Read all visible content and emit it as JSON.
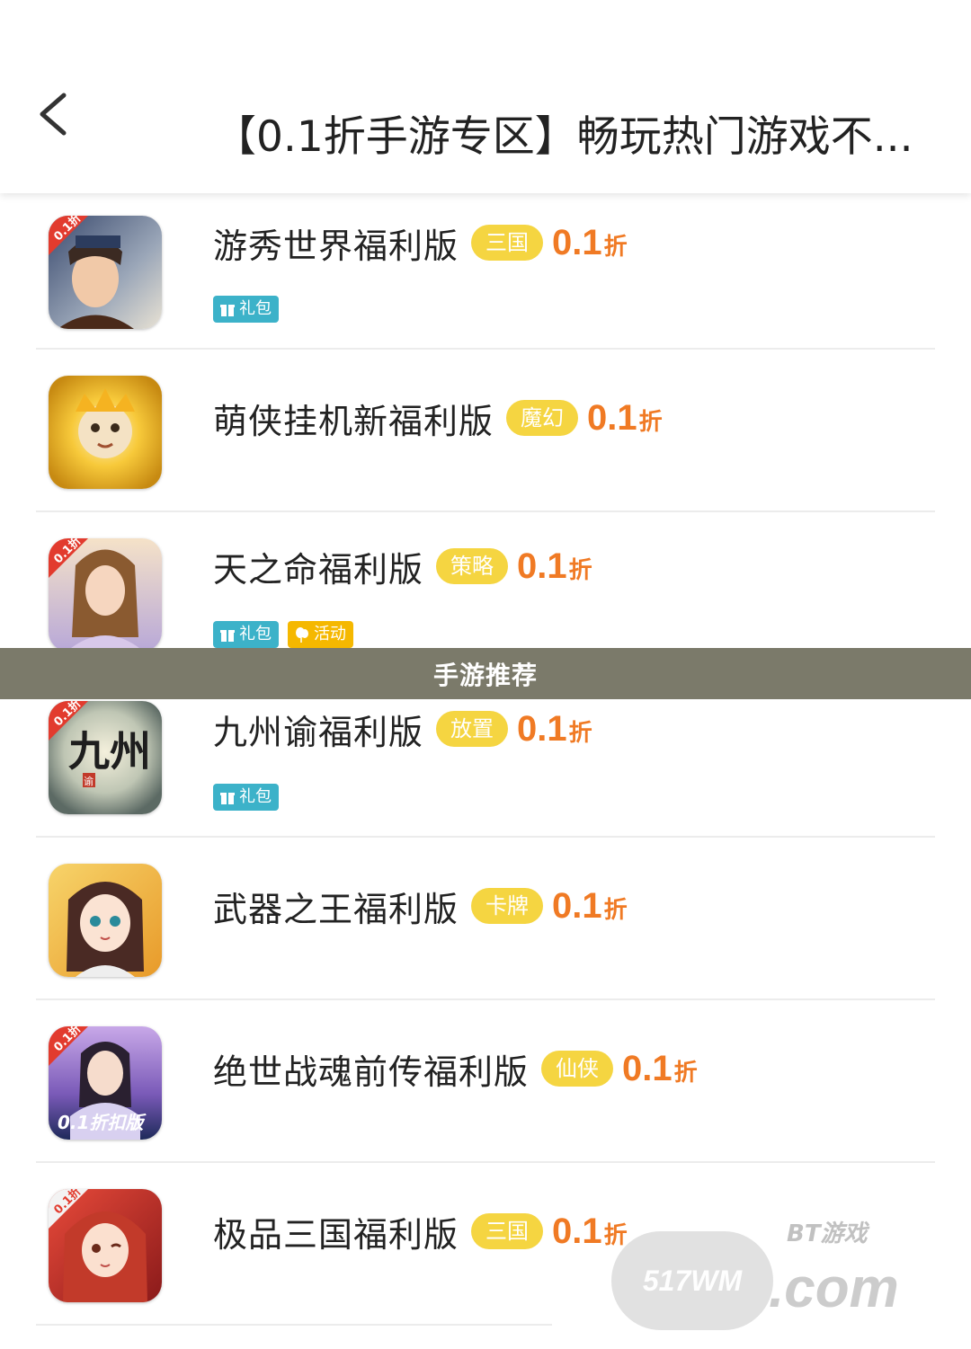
{
  "header": {
    "back_icon": "chevron-left-icon",
    "title": "【0.1折手游专区】畅玩热门游戏不..."
  },
  "overlay_banner": {
    "text": "手游推荐"
  },
  "discount_unit": "折",
  "games": [
    {
      "name": "游秀世界福利版",
      "genre": "三国",
      "discount": "0.1",
      "discount_unit": "折",
      "badges": [
        {
          "type": "gift",
          "label": "礼包"
        }
      ],
      "icon": "game-icon-warrior",
      "icon_label": "0.1折"
    },
    {
      "name": "萌侠挂机新福利版",
      "genre": "魔幻",
      "discount": "0.1",
      "discount_unit": "折",
      "badges": [],
      "icon": "game-icon-golden-monkey"
    },
    {
      "name": "天之命福利版",
      "genre": "策略",
      "discount": "0.1",
      "discount_unit": "折",
      "badges": [
        {
          "type": "gift",
          "label": "礼包"
        },
        {
          "type": "event",
          "label": "活动"
        }
      ],
      "icon": "game-icon-lady",
      "icon_label": "0.1折"
    },
    {
      "name": "九州谕福利版",
      "genre": "放置",
      "discount": "0.1",
      "discount_unit": "折",
      "badges": [
        {
          "type": "gift",
          "label": "礼包"
        }
      ],
      "icon": "game-icon-calligraphy",
      "icon_label": "0.1折",
      "icon_text": "九州",
      "icon_seal": "谕"
    },
    {
      "name": "武器之王福利版",
      "genre": "卡牌",
      "discount": "0.1",
      "discount_unit": "折",
      "badges": [],
      "icon": "game-icon-anime-girl"
    },
    {
      "name": "绝世战魂前传福利版",
      "genre": "仙侠",
      "discount": "0.1",
      "discount_unit": "折",
      "badges": [],
      "icon": "game-icon-fairy",
      "icon_label": "0.1折",
      "icon_text": "0.1折扣版"
    },
    {
      "name": "极品三国福利版",
      "genre": "三国",
      "discount": "0.1",
      "discount_unit": "折",
      "badges": [],
      "icon": "game-icon-redhair",
      "icon_label": "0.1折"
    }
  ],
  "watermark": {
    "left_text": "517WM",
    "top_text": "BT游戏",
    "bottom_text": ".com"
  },
  "colors": {
    "genre_tag": "#f5d541",
    "discount": "#f07a24",
    "gift_badge": "#3cb2c9",
    "event_badge": "#f5b800",
    "banner": "#7b7a6a"
  }
}
